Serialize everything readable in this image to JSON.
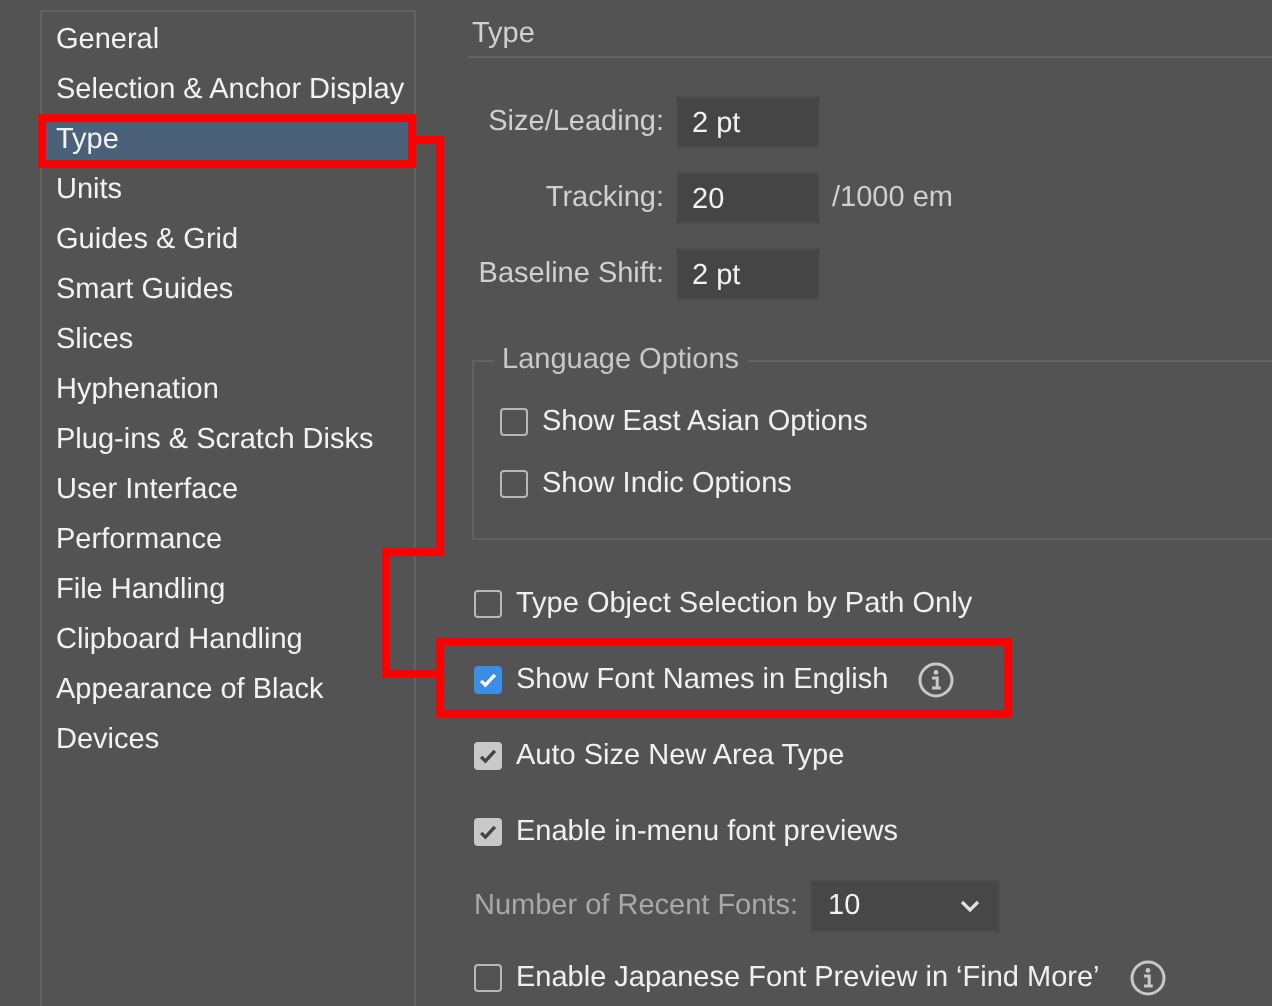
{
  "sidebar": {
    "items": [
      {
        "label": "General",
        "selected": false
      },
      {
        "label": "Selection & Anchor Display",
        "selected": false
      },
      {
        "label": "Type",
        "selected": true
      },
      {
        "label": "Units",
        "selected": false
      },
      {
        "label": "Guides & Grid",
        "selected": false
      },
      {
        "label": "Smart Guides",
        "selected": false
      },
      {
        "label": "Slices",
        "selected": false
      },
      {
        "label": "Hyphenation",
        "selected": false
      },
      {
        "label": "Plug-ins & Scratch Disks",
        "selected": false
      },
      {
        "label": "User Interface",
        "selected": false
      },
      {
        "label": "Performance",
        "selected": false
      },
      {
        "label": "File Handling",
        "selected": false
      },
      {
        "label": "Clipboard Handling",
        "selected": false
      },
      {
        "label": "Appearance of Black",
        "selected": false
      },
      {
        "label": "Devices",
        "selected": false
      }
    ]
  },
  "section": {
    "title": "Type",
    "fields": [
      {
        "label": "Size/Leading:",
        "value": "2 pt"
      },
      {
        "label": "Tracking:",
        "value": "20",
        "unit": "/1000 em"
      },
      {
        "label": "Baseline Shift:",
        "value": "2 pt"
      }
    ],
    "language_options": {
      "title": "Language Options",
      "options": [
        {
          "label": "Show East Asian Options",
          "checked": false
        },
        {
          "label": "Show Indic Options",
          "checked": false
        }
      ]
    },
    "options": [
      {
        "kind": "checkbox",
        "label": "Type Object Selection by Path Only",
        "checked": false,
        "focused": false,
        "info_icon": false
      },
      {
        "kind": "checkbox",
        "label": "Show Font Names in English",
        "checked": true,
        "focused": true,
        "info_icon": true
      },
      {
        "kind": "checkbox",
        "label": "Auto Size New Area Type",
        "checked": true,
        "focused": false,
        "info_icon": false
      },
      {
        "kind": "checkbox",
        "label": "Enable in-menu font previews",
        "checked": true,
        "focused": false,
        "info_icon": false
      },
      {
        "kind": "dropdown",
        "label": "Number of Recent Fonts:",
        "value": "10"
      },
      {
        "kind": "checkbox",
        "label": "Enable Japanese Font Preview in ‘Find More’",
        "checked": false,
        "focused": false,
        "info_icon": true
      }
    ]
  }
}
